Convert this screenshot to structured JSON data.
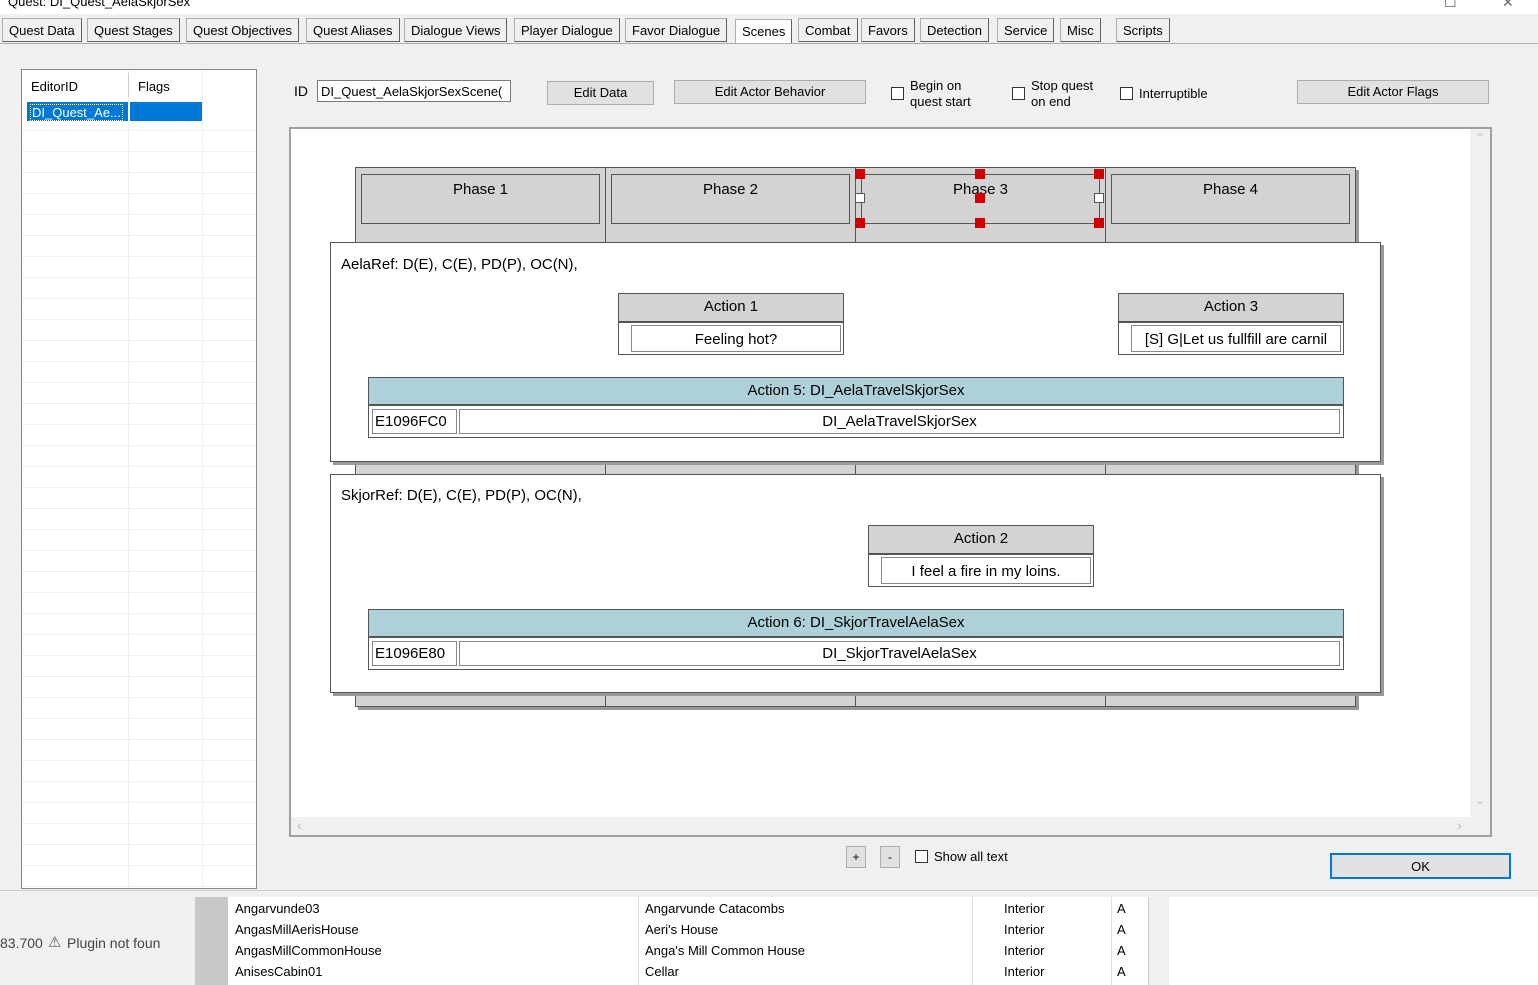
{
  "window": {
    "title": "Quest: DI_Quest_AelaSkjorSex"
  },
  "tabs": [
    {
      "label": "Quest Data"
    },
    {
      "label": "Quest Stages"
    },
    {
      "label": "Quest Objectives"
    },
    {
      "label": "Quest Aliases"
    },
    {
      "label": "Dialogue Views"
    },
    {
      "label": "Player Dialogue"
    },
    {
      "label": "Favor Dialogue"
    },
    {
      "label": "Scenes"
    },
    {
      "label": "Combat"
    },
    {
      "label": "Favors"
    },
    {
      "label": "Detection"
    },
    {
      "label": "Service"
    },
    {
      "label": "Misc"
    },
    {
      "label": "Scripts"
    }
  ],
  "scene_list": {
    "columns": [
      "EditorID",
      "Flags"
    ],
    "rows": [
      {
        "editor_id": "DI_Quest_Ae...",
        "flags": ""
      }
    ]
  },
  "form": {
    "id_label": "ID",
    "id_value": "DI_Quest_AelaSkjorSexScene(",
    "edit_data": "Edit Data",
    "edit_actor_behavior": "Edit Actor Behavior",
    "begin_on_quest_start": "Begin on\nquest start",
    "stop_quest_on_end": "Stop quest\non end",
    "interruptible": "Interruptible",
    "edit_actor_flags": "Edit Actor Flags"
  },
  "scene": {
    "phases": [
      "Phase 1",
      "Phase 2",
      "Phase 3",
      "Phase 4"
    ],
    "selected_phase": 3,
    "actors": [
      {
        "header": "AelaRef: D(E), C(E), PD(P), OC(N),",
        "actions": [
          {
            "title": "Action 1",
            "text": "Feeling hot?"
          },
          {
            "title": "Action 3",
            "text": "[S] G|Let us fullfill are carnil"
          }
        ],
        "package": {
          "title": "Action 5: DI_AelaTravelSkjorSex",
          "id": "E1096FC0",
          "name": "DI_AelaTravelSkjorSex"
        }
      },
      {
        "header": "SkjorRef: D(E), C(E), PD(P), OC(N),",
        "actions": [
          {
            "title": "Action 2",
            "text": "I feel a fire in my loins."
          }
        ],
        "package": {
          "title": "Action 6: DI_SkjorTravelAelaSex",
          "id": "E1096E80",
          "name": "DI_SkjorTravelAelaSex"
        }
      }
    ]
  },
  "footer": {
    "plus": "+",
    "minus": "-",
    "show_all_text": "Show all text",
    "ok": "OK"
  },
  "background": {
    "status_value": "83.700",
    "status_msg": "Plugin not foun",
    "cells": [
      {
        "editor_id": "Angarvunde03",
        "name": "Angarvunde Catacombs",
        "type": "Interior",
        "extra": "A"
      },
      {
        "editor_id": "AngasMillAerisHouse",
        "name": "Aeri's House",
        "type": "Interior",
        "extra": "A"
      },
      {
        "editor_id": "AngasMillCommonHouse",
        "name": "Anga's Mill Common House",
        "type": "Interior",
        "extra": "A"
      },
      {
        "editor_id": "AnisesCabin01",
        "name": "Cellar",
        "type": "Interior",
        "extra": "A"
      }
    ]
  },
  "colors": {
    "selection": "#0078d7",
    "package_header": "#aed0d8",
    "phase_handle": "#d00000"
  }
}
